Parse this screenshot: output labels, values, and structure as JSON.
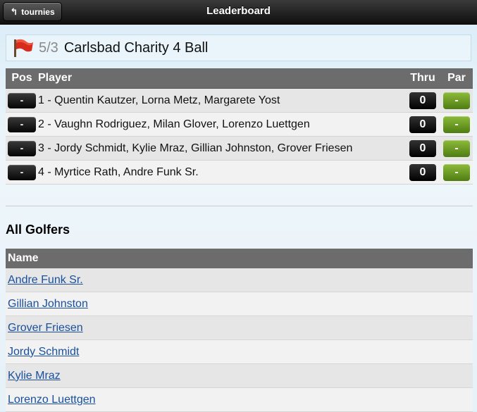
{
  "header": {
    "back_label": "tournies",
    "title": "Leaderboard"
  },
  "tournament": {
    "round": "5/3",
    "name": "Carlsbad Charity 4 Ball"
  },
  "leaderboard": {
    "columns": {
      "pos": "Pos",
      "player": "Player",
      "thru": "Thru",
      "par": "Par"
    },
    "rows": [
      {
        "pos": "-",
        "player": "1 - Quentin Kautzer, Lorna Metz, Margarete Yost",
        "thru": "0",
        "par": "-"
      },
      {
        "pos": "-",
        "player": "2 - Vaughn Rodriguez, Milan Glover, Lorenzo Luettgen",
        "thru": "0",
        "par": "-"
      },
      {
        "pos": "-",
        "player": "3 - Jordy Schmidt, Kylie Mraz, Gillian Johnston, Grover Friesen",
        "thru": "0",
        "par": "-"
      },
      {
        "pos": "-",
        "player": "4 - Myrtice Rath, Andre Funk Sr.",
        "thru": "0",
        "par": "-"
      }
    ]
  },
  "golfers": {
    "title": "All Golfers",
    "column": "Name",
    "rows": [
      "Andre Funk Sr.",
      "Gillian Johnston",
      "Grover Friesen",
      "Jordy Schmidt",
      "Kylie Mraz",
      "Lorenzo Luettgen"
    ]
  },
  "colors": {
    "link": "#1a4f9c",
    "par_badge": "#6a9a22",
    "header_bar": "#6c6c6c"
  },
  "icons": {
    "back": "left-arrow-icon",
    "tournament": "red-flag-icon"
  }
}
